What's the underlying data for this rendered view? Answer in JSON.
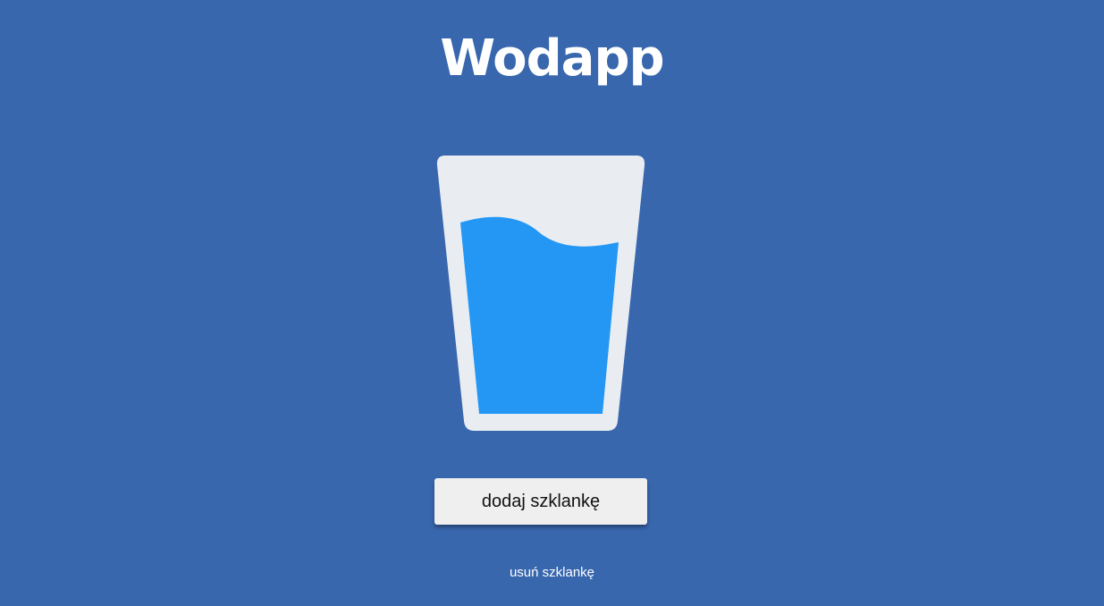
{
  "header": {
    "title": "Wodapp"
  },
  "glass": {
    "icon": "glass-of-water-icon",
    "fill_level": 0.75,
    "glass_color": "#e9edf1",
    "water_color": "#2497f5"
  },
  "actions": {
    "add_label": "dodaj szklankę",
    "remove_label": "usuń szklankę"
  },
  "colors": {
    "background": "#3867ae",
    "button_bg": "#efefef",
    "text_light": "#ffffff"
  }
}
